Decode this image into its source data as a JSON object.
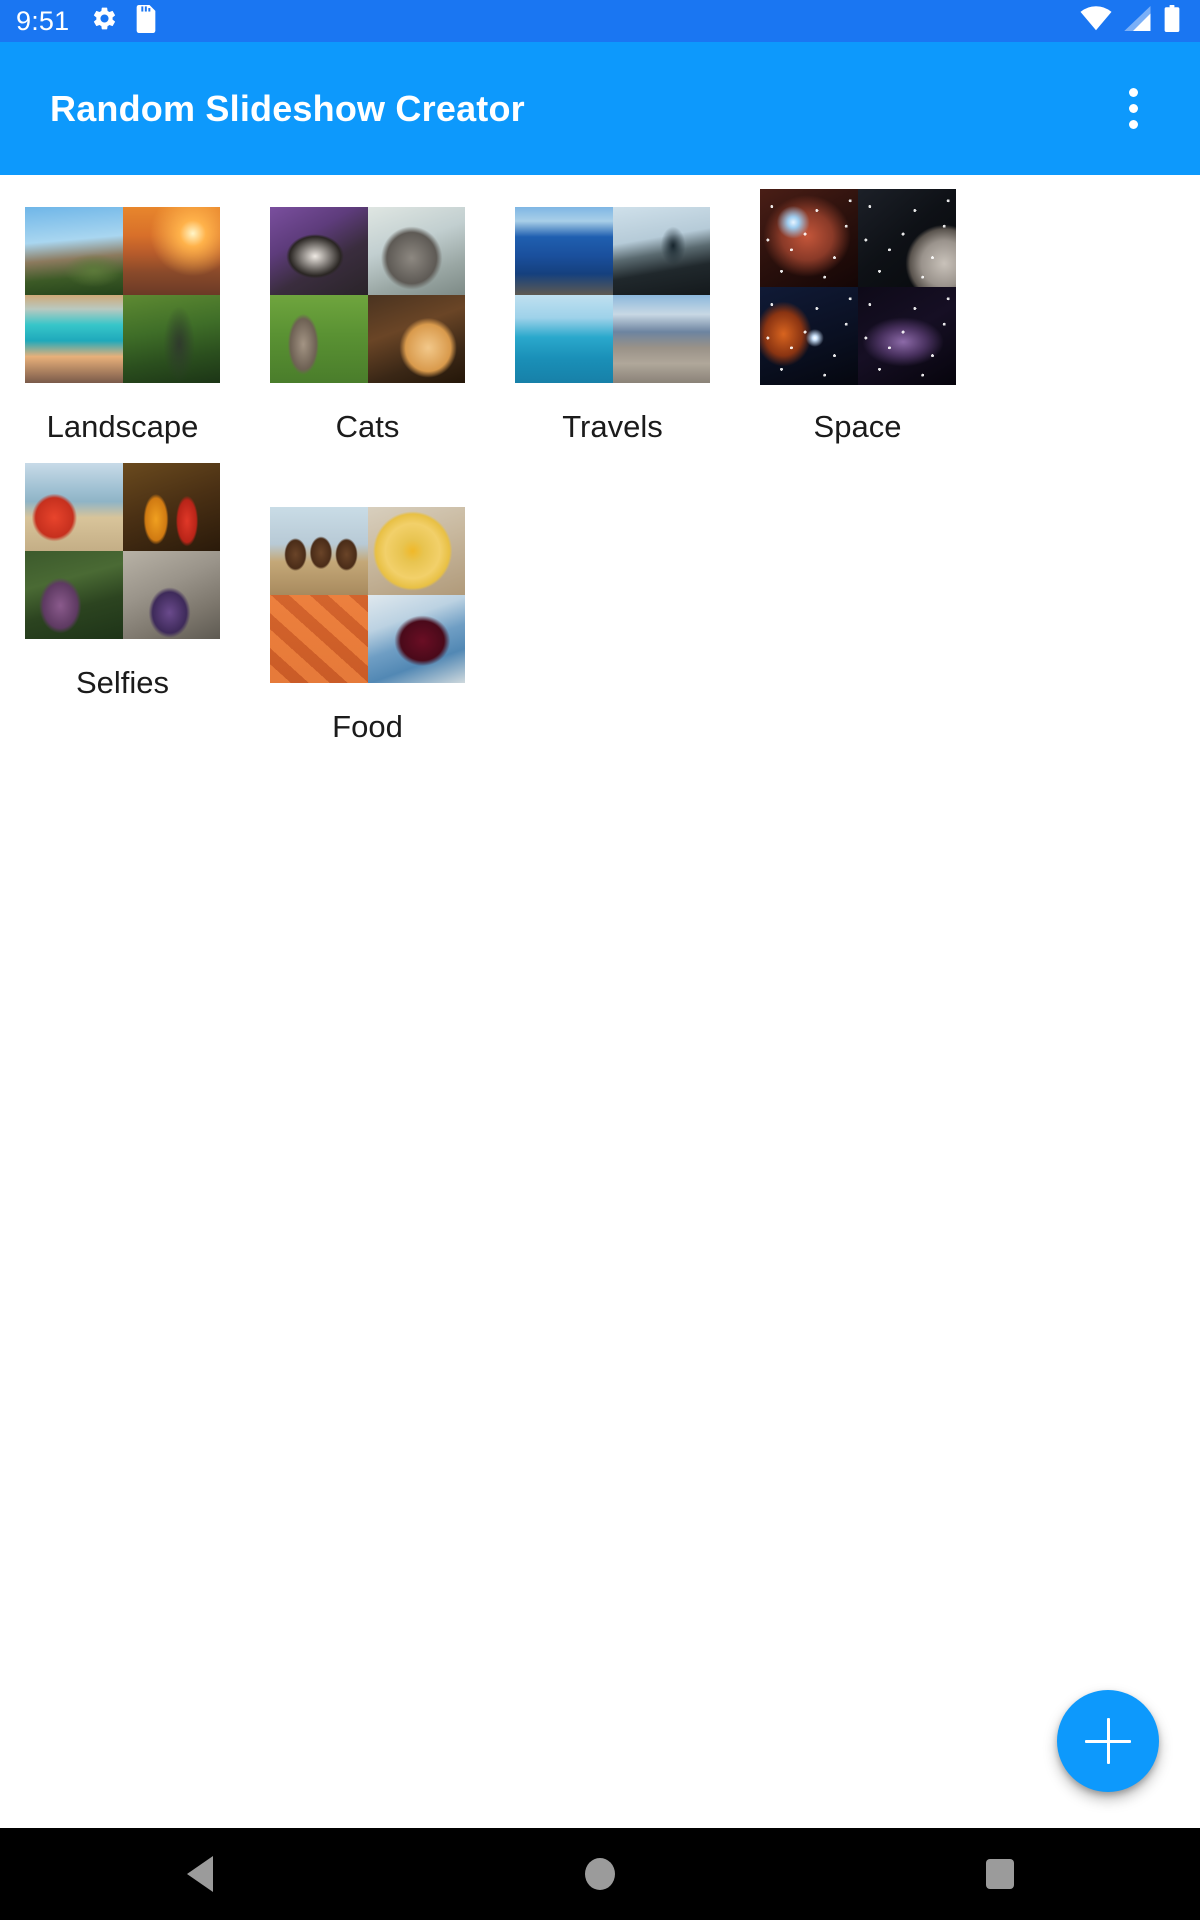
{
  "status_bar": {
    "clock": "9:51",
    "left_icons": [
      "gear-icon",
      "sd-card-icon"
    ],
    "right_icons": [
      "wifi-icon",
      "cellular-signal-icon",
      "battery-icon"
    ],
    "background_color": "#1a76f2"
  },
  "app_bar": {
    "title": "Random Slideshow Creator",
    "overflow_icon": "overflow-menu-icon",
    "background_color": "#0d99fc",
    "text_color": "#ffffff"
  },
  "albums": [
    {
      "label": "Landscape",
      "tiles": [
        "palm-trees-mountain",
        "ocean-sunset",
        "turquoise-beach",
        "green-waterfall"
      ],
      "tall": false
    },
    {
      "label": "Cats",
      "tiles": [
        "cat-on-purple-blanket",
        "grey-tabby-looking-up",
        "bengal-cat-on-grass",
        "orange-cat-closeup"
      ],
      "tall": false
    },
    {
      "label": "Travels",
      "tiles": [
        "harbor-with-boats",
        "person-silhouette-on-cliff",
        "boat-on-turquoise-sea",
        "crowded-pier-boardwalk"
      ],
      "tall": false
    },
    {
      "label": "Space",
      "tiles": [
        "red-star-nebula",
        "moon-and-milky-way",
        "orange-nebula-burst",
        "purple-milky-way"
      ],
      "tall": true
    },
    {
      "label": "Selfies",
      "tiles": [
        "two-women-on-beach",
        "three-women-in-saris",
        "woman-with-phone-outdoors",
        "two-women-selfie-on-rock"
      ],
      "tall": false
    },
    {
      "label": "Food",
      "tiles": [
        "chocolate-muffins",
        "sliced-yellow-pie",
        "cooked-shrimp",
        "cherries-in-blue-bowl"
      ],
      "tall": false
    }
  ],
  "fab": {
    "icon": "plus-icon",
    "label": "Add slideshow",
    "color": "#0d99fc"
  },
  "navigation_bar": {
    "back_label": "Back",
    "home_label": "Home",
    "recents_label": "Recents",
    "background_color": "#000000",
    "icon_color": "#9b9b9b"
  }
}
